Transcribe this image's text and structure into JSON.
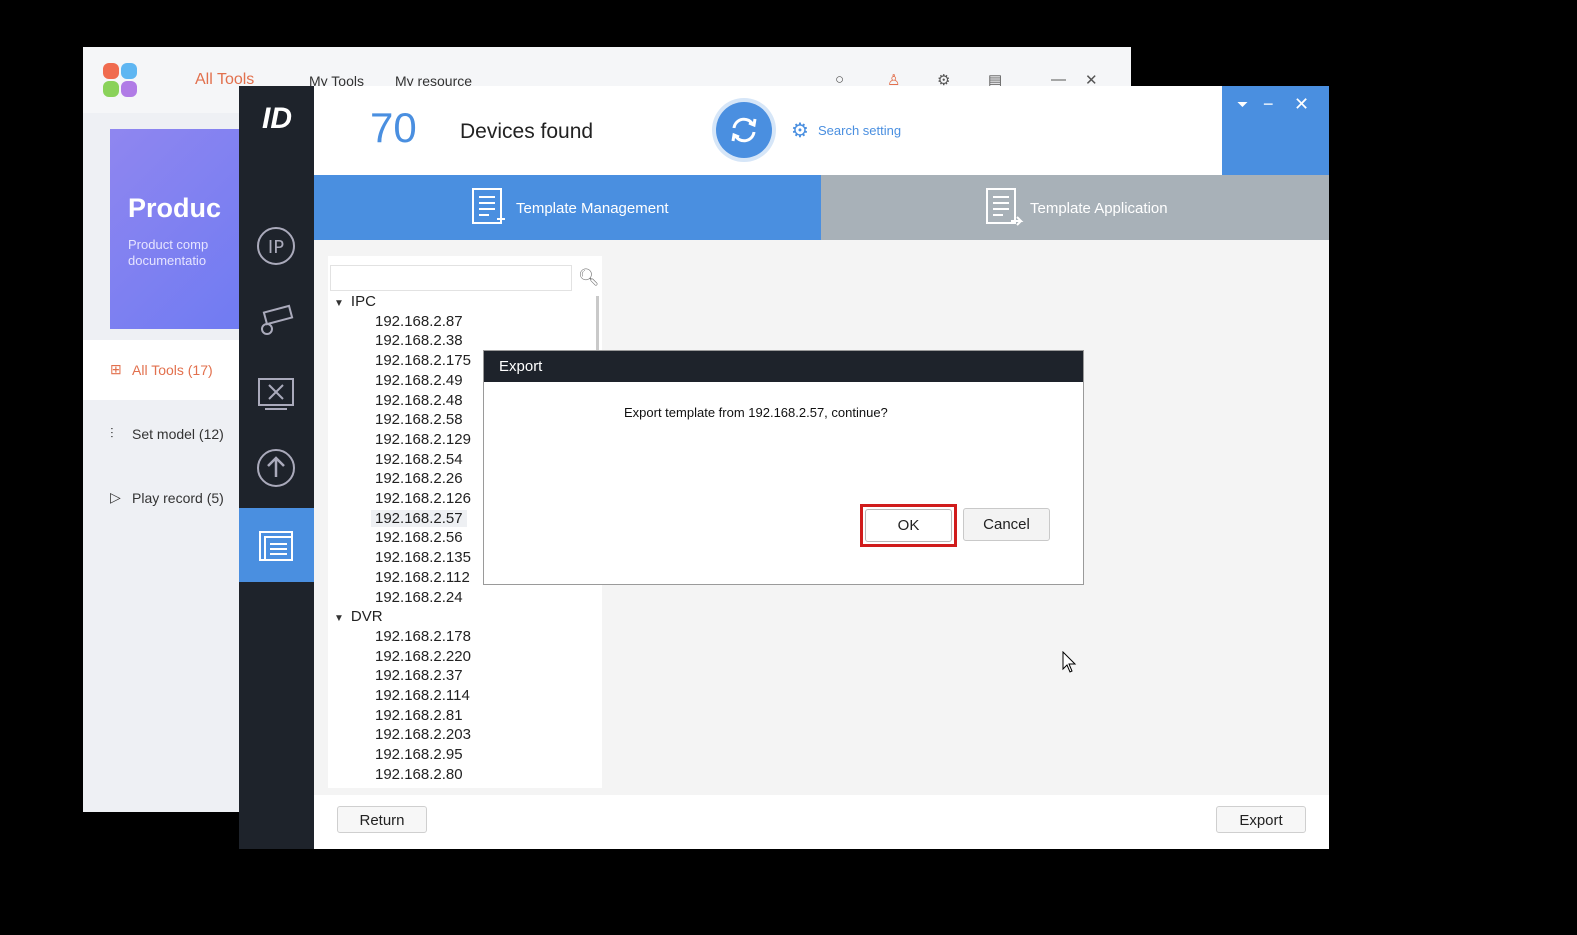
{
  "launcher": {
    "tabs": [
      "All Tools",
      "My Tools",
      "My resource"
    ],
    "banner_title": "Produc",
    "banner_sub_1": "Product comp",
    "banner_sub_2": "documentatio",
    "sidebar": [
      {
        "label": "All Tools (17)",
        "icon": "grid-icon"
      },
      {
        "label": "Set model (12)",
        "icon": "sliders-icon"
      },
      {
        "label": "Play record (5)",
        "icon": "play-icon"
      }
    ]
  },
  "header": {
    "device_count": "70",
    "devices_found_label": "Devices found",
    "search_setting_label": "Search setting"
  },
  "tabs": {
    "template_management": "Template Management",
    "template_application": "Template Application"
  },
  "tree": {
    "groups": [
      {
        "name": "IPC",
        "items": [
          "192.168.2.87",
          "192.168.2.38",
          "192.168.2.175",
          "192.168.2.49",
          "192.168.2.48",
          "192.168.2.58",
          "192.168.2.129",
          "192.168.2.54",
          "192.168.2.26",
          "192.168.2.126",
          "192.168.2.57",
          "192.168.2.56",
          "192.168.2.135",
          "192.168.2.112",
          "192.168.2.24"
        ]
      },
      {
        "name": "DVR",
        "items": [
          "192.168.2.178",
          "192.168.2.220",
          "192.168.2.37",
          "192.168.2.114",
          "192.168.2.81",
          "192.168.2.203",
          "192.168.2.95",
          "192.168.2.80"
        ]
      }
    ],
    "selected": "192.168.2.57"
  },
  "bottom": {
    "return_label": "Return",
    "export_label": "Export"
  },
  "dialog": {
    "title": "Export",
    "message": "Export template from 192.168.2.57, continue?",
    "ok_label": "OK",
    "cancel_label": "Cancel"
  },
  "colors": {
    "accent": "#4a8fe0",
    "sidebar_dark": "#1e232b",
    "highlight_red": "#d01c1c",
    "launcher_accent": "#e2704d"
  }
}
